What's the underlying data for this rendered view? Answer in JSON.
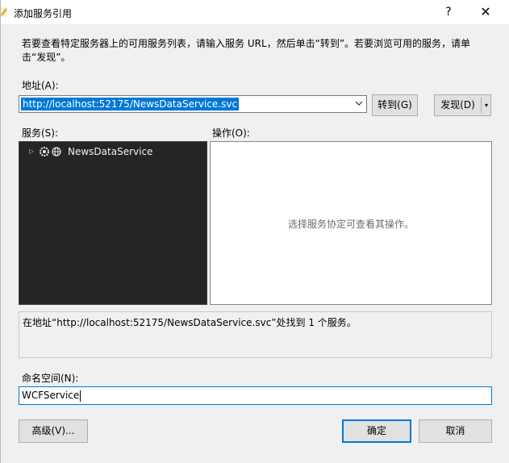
{
  "window": {
    "title": "添加服务引用",
    "help_label": "?",
    "close_label": "✕"
  },
  "instruction": "若要查看特定服务器上的可用服务列表，请输入服务 URL，然后单击“转到”。若要浏览可用的服务，请单击“发现”。",
  "address": {
    "label": "地址(A):",
    "value": "http://localhost:52175/NewsDataService.svc",
    "go_label": "转到(G)",
    "discover_label": "发现(D)",
    "discover_arrow": "▾"
  },
  "services": {
    "label": "服务(S):",
    "items": [
      {
        "label": "NewsDataService",
        "expander": "▷"
      }
    ]
  },
  "operations": {
    "label": "操作(O):",
    "empty_text": "选择服务协定可查看其操作。"
  },
  "status_text": "在地址“http://localhost:52175/NewsDataService.svc”处找到 1 个服务。",
  "namespace": {
    "label": "命名空间(N):",
    "value": "WCFService"
  },
  "buttons": {
    "advanced": "高级(V)...",
    "ok": "确定",
    "cancel": "取消"
  },
  "colors": {
    "accent": "#0078d7",
    "tree_bg": "#252526",
    "dialog_bg": "#f0f0f0"
  }
}
